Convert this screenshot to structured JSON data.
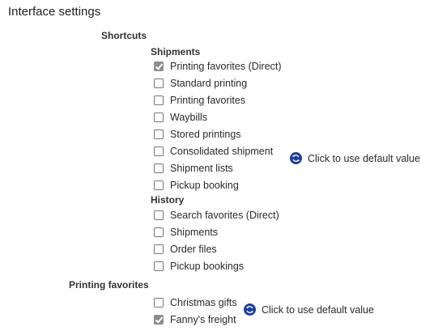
{
  "page_title": "Interface settings",
  "shortcuts": {
    "heading": "Shortcuts",
    "shipments": {
      "heading": "Shipments",
      "items": [
        {
          "label": "Printing favorites (Direct)",
          "checked": true
        },
        {
          "label": "Standard printing",
          "checked": false
        },
        {
          "label": "Printing favorites",
          "checked": false
        },
        {
          "label": "Waybills",
          "checked": false
        },
        {
          "label": "Stored printings",
          "checked": false
        },
        {
          "label": "Consolidated shipment",
          "checked": false
        },
        {
          "label": "Shipment lists",
          "checked": false
        },
        {
          "label": "Pickup booking",
          "checked": false
        }
      ]
    },
    "history": {
      "heading": "History",
      "items": [
        {
          "label": "Search favorites (Direct)",
          "checked": false
        },
        {
          "label": "Shipments",
          "checked": false
        },
        {
          "label": "Order files",
          "checked": false
        },
        {
          "label": "Pickup bookings",
          "checked": false
        }
      ]
    },
    "default_link": "Click to use default value"
  },
  "printing_favorites": {
    "heading": "Printing favorites",
    "items": [
      {
        "label": "Christmas gifts",
        "checked": false
      },
      {
        "label": "Fanny's freight",
        "checked": true
      }
    ],
    "default_link": "Click to use default value"
  },
  "icons": {
    "reset": "reset-default-icon"
  },
  "colors": {
    "reset_icon": "#1f3f9a",
    "checked_box": "#8c8c8c"
  }
}
